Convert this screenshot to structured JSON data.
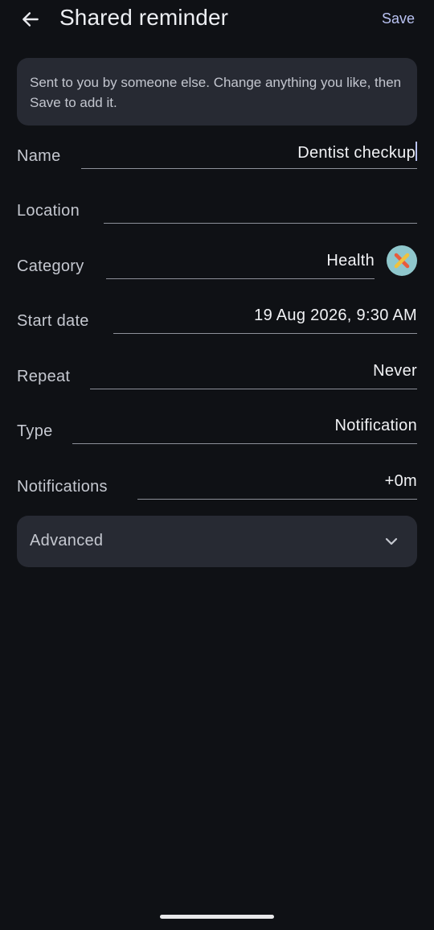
{
  "header": {
    "title": "Shared reminder",
    "save_label": "Save",
    "back_icon": "arrow-left-icon"
  },
  "info": {
    "text": "Sent to you by someone else. Change anything you like, then Save to add it."
  },
  "fields": {
    "name": {
      "label": "Name",
      "value": "Dentist checkup"
    },
    "location": {
      "label": "Location",
      "value": ""
    },
    "category": {
      "label": "Category",
      "value": "Health",
      "icon": "category-color-icon"
    },
    "start_date": {
      "label": "Start date",
      "value": "19 Aug 2026, 9:30 AM"
    },
    "repeat": {
      "label": "Repeat",
      "value": "Never"
    },
    "type": {
      "label": "Type",
      "value": "Notification"
    },
    "notifications": {
      "label": "Notifications",
      "value": "+0m"
    }
  },
  "advanced": {
    "label": "Advanced",
    "icon": "chevron-down-icon"
  },
  "colors": {
    "background": "#0f1115",
    "card": "#272a33",
    "accent": "#b9c2f2",
    "category_icon_bg": "#8fc7cc"
  }
}
